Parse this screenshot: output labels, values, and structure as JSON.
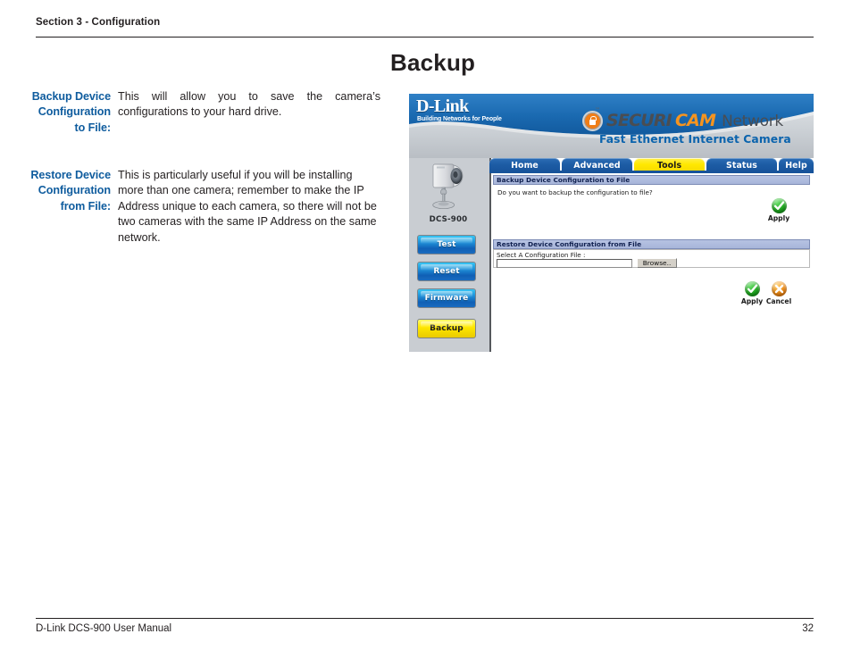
{
  "page": {
    "section_label": "Section 3 - Configuration",
    "title": "Backup",
    "footer_left": "D-Link DCS-900 User Manual",
    "footer_page": "32",
    "accent_blue": "#0f5c9e",
    "text_color": "#231f20"
  },
  "descriptions": [
    {
      "label": "Backup Device Configuration to File:",
      "body": "This will allow you to save the camera’s configurations to your hard drive."
    },
    {
      "label": "Restore Device Configuration from File:",
      "body": "This is particularly useful if you will be installing more than one camera; remember to make the IP Address unique to each camera, so there will not be two cameras with the same IP Address on the same network."
    }
  ],
  "screenshot": {
    "banner": {
      "logo": "D-Link",
      "tagline": "Building Networks for People",
      "brand_prefix": "SECURI",
      "brand_suffix": "CAM",
      "brand_network": "Network",
      "trademark": "™",
      "product_line": "Fast Ethernet Internet Camera",
      "brand_orange": "#f5941f",
      "banner_blue": "#1a69b0"
    },
    "nav": {
      "tabs": [
        {
          "label": "Home",
          "selected": false
        },
        {
          "label": "Advanced",
          "selected": false
        },
        {
          "label": "Tools",
          "selected": true
        },
        {
          "label": "Status",
          "selected": false
        },
        {
          "label": "Help",
          "selected": false
        }
      ]
    },
    "rail": {
      "device_name": "DCS-900",
      "buttons": [
        {
          "label": "Test",
          "style": "blue"
        },
        {
          "label": "Reset",
          "style": "blue"
        },
        {
          "label": "Firmware",
          "style": "blue"
        },
        {
          "label": "Backup",
          "style": "yellow"
        }
      ]
    },
    "backup_section": {
      "heading": "Backup Device Configuration to File",
      "question": "Do you want to backup the configuration to file?",
      "apply_label": "Apply"
    },
    "restore_section": {
      "heading": "Restore Device Configuration from File",
      "field_label": "Select A Configuration File :",
      "file_value": "",
      "browse_label": "Browse..",
      "apply_label": "Apply",
      "cancel_label": "Cancel"
    }
  }
}
